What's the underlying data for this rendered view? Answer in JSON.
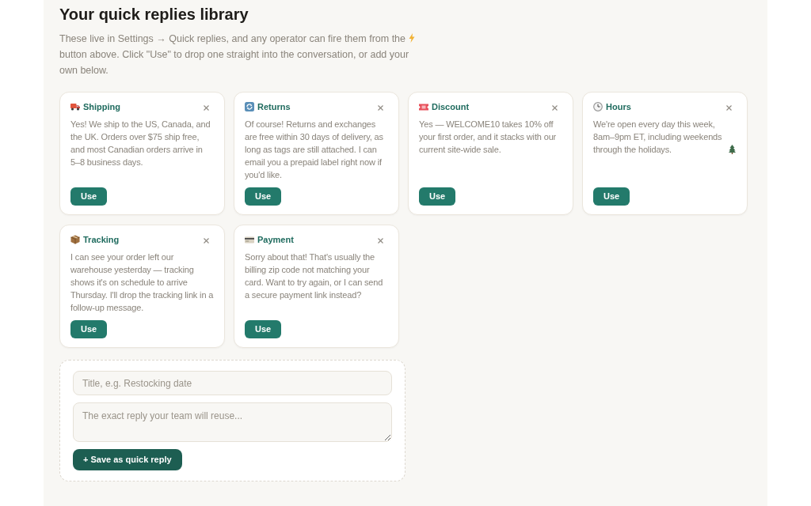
{
  "header": {
    "title": "Your quick replies library",
    "description": {
      "lead": "These live in Settings → Quick replies, and any operator can fire them from the",
      "rest": "button above. Click \"Use\" to drop one straight into the conversation, or add your own below."
    }
  },
  "replies": [
    {
      "kind": "shipping",
      "title": "Shipping",
      "text": "Yes! We ship to the US, Canada, and the UK. Orders over $75 ship free, and most Canadian orders arrive in 5–8 business days.",
      "button": "Use"
    },
    {
      "kind": "returns",
      "title": "Returns",
      "text": "Of course! Returns and exchanges are free within 30 days of delivery, as long as tags are still attached. I can email you a prepaid label right now if you'd like.",
      "button": "Use"
    },
    {
      "kind": "discount",
      "title": "Discount",
      "text": "Yes — WELCOME10 takes 10% off your first order, and it stacks with our current site-wide sale.",
      "button": "Use"
    },
    {
      "kind": "hours",
      "title": "Hours",
      "text": "We're open every day this week, 8am–9pm ET, including weekends through the holidays.",
      "button": "Use"
    },
    {
      "kind": "tracking",
      "title": "Tracking",
      "text": "I can see your order left our warehouse yesterday — tracking shows it's on schedule to arrive Thursday. I'll drop the tracking link in a follow-up message.",
      "button": "Use"
    },
    {
      "kind": "payment",
      "title": "Payment",
      "text": "Sorry about that! That's usually the billing zip code not matching your card. Want to try again, or I can send a secure payment link instead?",
      "button": "Use"
    }
  ],
  "new_reply_form": {
    "title_field": {
      "placeholder": "Title, e.g. Restocking date"
    },
    "reply_field": {
      "placeholder": "The exact reply your team will reuse..."
    },
    "save_button": "+ Save as quick reply"
  }
}
